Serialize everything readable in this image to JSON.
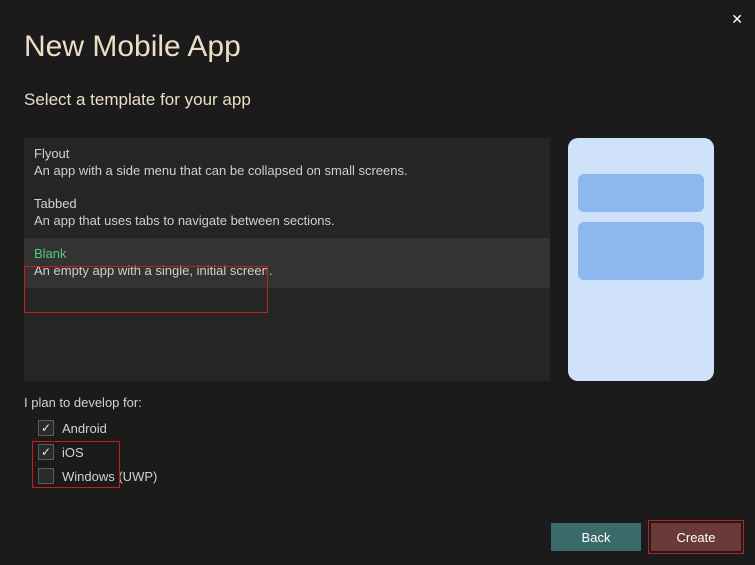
{
  "title": "New Mobile App",
  "subtitle": "Select a template for your app",
  "templates": [
    {
      "name": "Flyout",
      "desc": "An app with a side menu that can be collapsed on small screens.",
      "selected": false
    },
    {
      "name": "Tabbed",
      "desc": "An app that uses tabs to navigate between sections.",
      "selected": false
    },
    {
      "name": "Blank",
      "desc": "An empty app with a single, initial screen.",
      "selected": true
    }
  ],
  "develop_label": "I plan to develop for:",
  "platforms": [
    {
      "label": "Android",
      "checked": true
    },
    {
      "label": "iOS",
      "checked": true
    },
    {
      "label": "Windows (UWP)",
      "checked": false
    }
  ],
  "buttons": {
    "back": "Back",
    "create": "Create"
  }
}
